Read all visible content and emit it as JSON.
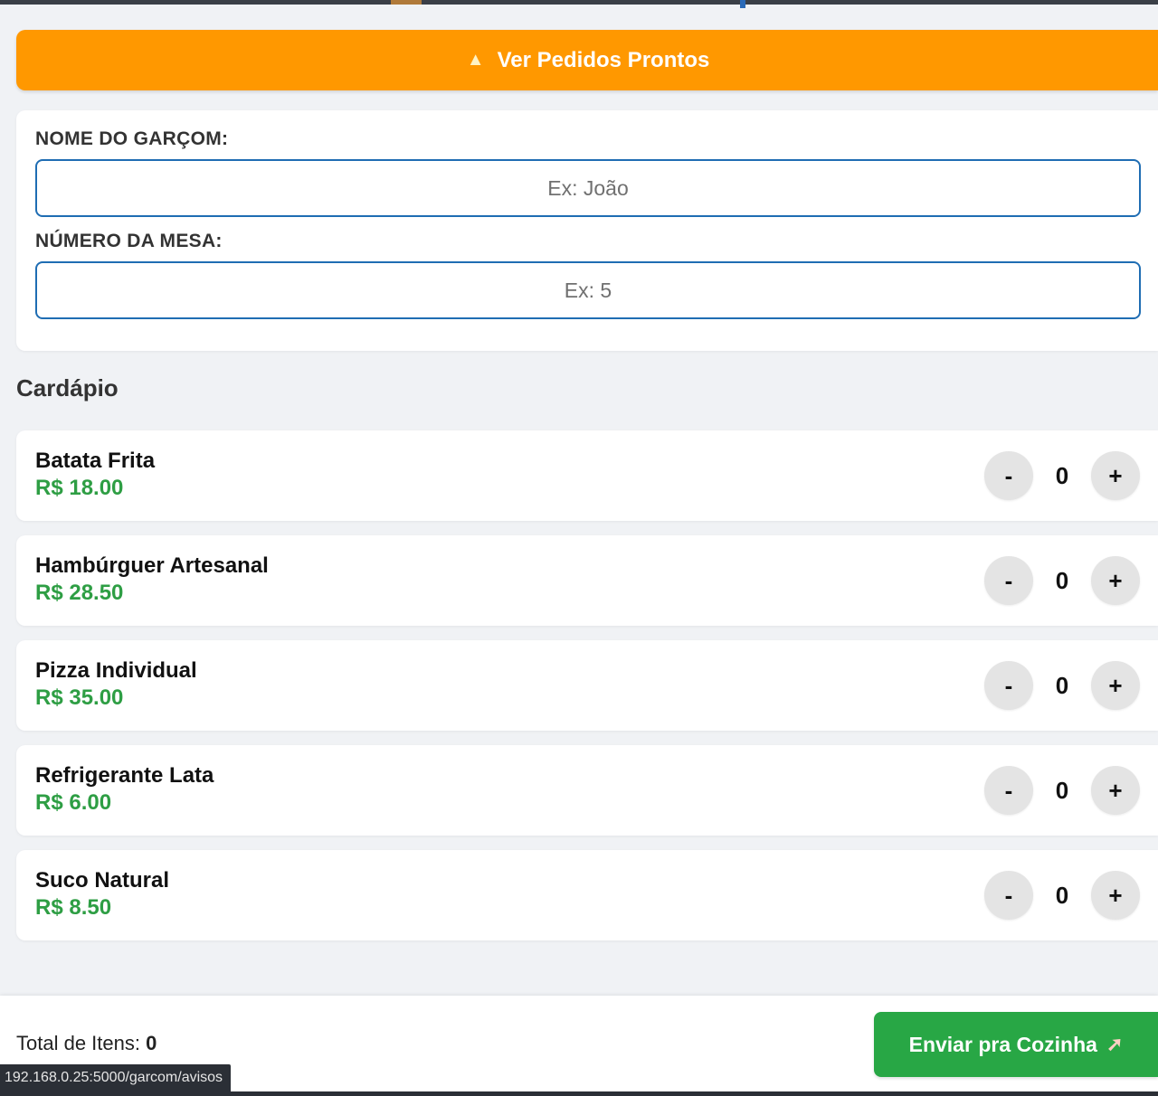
{
  "orders_button": {
    "icon": "bell-icon",
    "label": "Ver Pedidos Prontos"
  },
  "form": {
    "waiter_label": "NOME DO GARÇOM:",
    "waiter_placeholder": "Ex: João",
    "waiter_value": "",
    "table_label": "NÚMERO DA MESA:",
    "table_placeholder": "Ex: 5",
    "table_value": ""
  },
  "menu": {
    "title": "Cardápio",
    "items": [
      {
        "name": "Batata Frita",
        "price": "R$ 18.00",
        "qty": "0"
      },
      {
        "name": "Hambúrguer Artesanal",
        "price": "R$ 28.50",
        "qty": "0"
      },
      {
        "name": "Pizza Individual",
        "price": "R$ 35.00",
        "qty": "0"
      },
      {
        "name": "Refrigerante Lata",
        "price": "R$ 6.00",
        "qty": "0"
      },
      {
        "name": "Suco Natural",
        "price": "R$ 8.50",
        "qty": "0"
      }
    ],
    "minus_label": "-",
    "plus_label": "+"
  },
  "footer": {
    "total_label": "Total de Itens:",
    "total_value": "0",
    "send_label": "Enviar pra Cozinha",
    "send_icon": "rocket-icon"
  },
  "status_bar": {
    "url": "192.168.0.25:5000/garcom/avisos"
  },
  "colors": {
    "orders_button": "#ff9800",
    "send_button": "#28a745",
    "price": "#2e9e44",
    "input_border": "#1f6db3"
  }
}
